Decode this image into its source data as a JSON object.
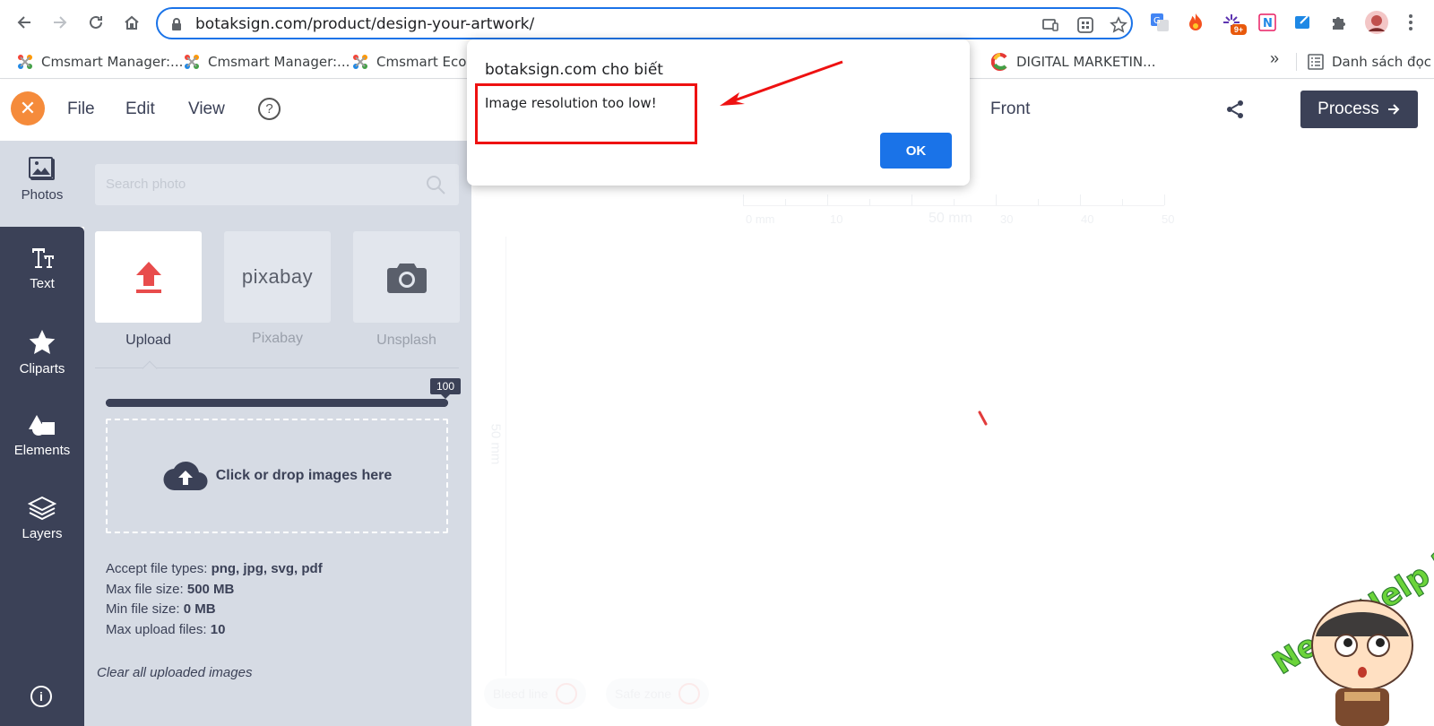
{
  "browser": {
    "url": "botaksign.com/product/design-your-artwork/",
    "bookmarks": [
      {
        "label": "Cmsmart Manager:..."
      },
      {
        "label": "Cmsmart Manager:..."
      },
      {
        "label": "Cmsmart Ecom..."
      },
      {
        "label": "DIGITAL MARKETIN..."
      }
    ],
    "bookmarks_more": "»",
    "reading_list": "Danh sách đọc",
    "extension_badge": "9+"
  },
  "header": {
    "menu": [
      "File",
      "Edit",
      "View"
    ],
    "help": "?",
    "side_label": "Front",
    "process_label": "Process"
  },
  "sidebar": {
    "items": [
      {
        "label": "Photos",
        "icon": "photos-icon"
      },
      {
        "label": "Text",
        "icon": "text-icon"
      },
      {
        "label": "Cliparts",
        "icon": "star-icon"
      },
      {
        "label": "Elements",
        "icon": "shapes-icon"
      },
      {
        "label": "Layers",
        "icon": "layers-icon"
      }
    ],
    "info": "i"
  },
  "panel": {
    "search_placeholder": "Search photo",
    "sources": [
      {
        "label": "Upload"
      },
      {
        "label": "Pixabay",
        "logo_text": "pixabay"
      },
      {
        "label": "Unsplash"
      }
    ],
    "progress": {
      "value": 100,
      "label": "100"
    },
    "dropzone_text": "Click or drop images here",
    "file_info": {
      "types_label": "Accept file types: ",
      "types_value": "png, jpg, svg, pdf",
      "max_size_label": "Max file size: ",
      "max_size_value": "500 MB",
      "min_size_label": "Min file size: ",
      "min_size_value": "0 MB",
      "max_files_label": "Max upload files: ",
      "max_files_value": "10"
    },
    "clear_label": "Clear all uploaded images"
  },
  "canvas": {
    "ruler_top": [
      "0 mm",
      "10",
      "50 mm",
      "30",
      "40",
      "50"
    ],
    "ruler_side_label": "50 mm",
    "bleed_label": "Bleed line",
    "safe_label": "Safe zone"
  },
  "help_widget": {
    "text": "Need Help ?"
  },
  "dialog": {
    "title": "botaksign.com cho biết",
    "message": "Image resolution too low!",
    "ok_label": "OK"
  },
  "colors": {
    "accent": "#1a73e8",
    "sidebar_dark": "#3b4157",
    "panel_bg": "#d6dbe4",
    "close_orange": "#f58b3b",
    "annotation_red": "#e11111",
    "upload_red": "#e84c4c"
  }
}
